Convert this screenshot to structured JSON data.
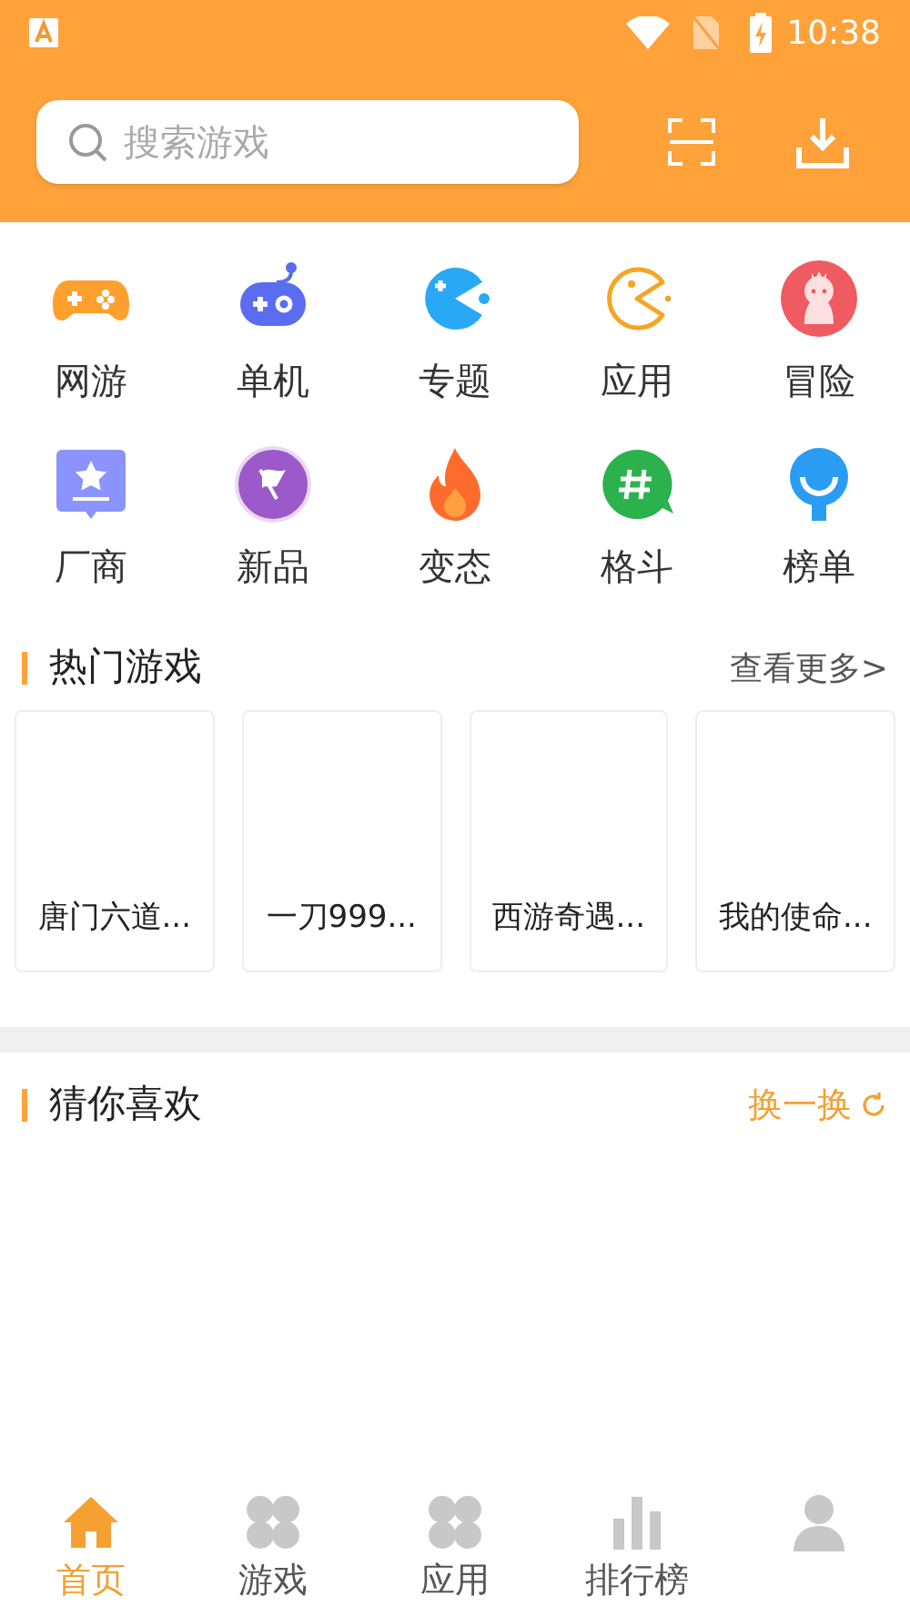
{
  "status_bar": {
    "time": "10:38"
  },
  "search": {
    "placeholder": "搜索游戏"
  },
  "categories": [
    {
      "label": "网游",
      "kind": "gamepad"
    },
    {
      "label": "单机",
      "kind": "robot"
    },
    {
      "label": "专题",
      "kind": "pacman-blue"
    },
    {
      "label": "应用",
      "kind": "pacman-outline"
    },
    {
      "label": "冒险",
      "kind": "mascot"
    },
    {
      "label": "厂商",
      "kind": "star-badge"
    },
    {
      "label": "新品",
      "kind": "flag"
    },
    {
      "label": "变态",
      "kind": "flame"
    },
    {
      "label": "格斗",
      "kind": "hash-bubble"
    },
    {
      "label": "榜单",
      "kind": "pin"
    }
  ],
  "hot_games": {
    "title": "热门游戏",
    "more": "查看更多>",
    "games": [
      "唐门六道...",
      "一刀999...",
      "西游奇遇...",
      "我的使命..."
    ]
  },
  "guess": {
    "title": "猜你喜欢",
    "refresh": "换一换"
  },
  "bottom_nav": [
    {
      "label": "首页",
      "kind": "home",
      "selected": true
    },
    {
      "label": "游戏",
      "kind": "grid",
      "selected": false
    },
    {
      "label": "应用",
      "kind": "grid",
      "selected": false
    },
    {
      "label": "排行榜",
      "kind": "bars",
      "selected": false
    },
    {
      "kind": "person",
      "selected": false
    }
  ]
}
